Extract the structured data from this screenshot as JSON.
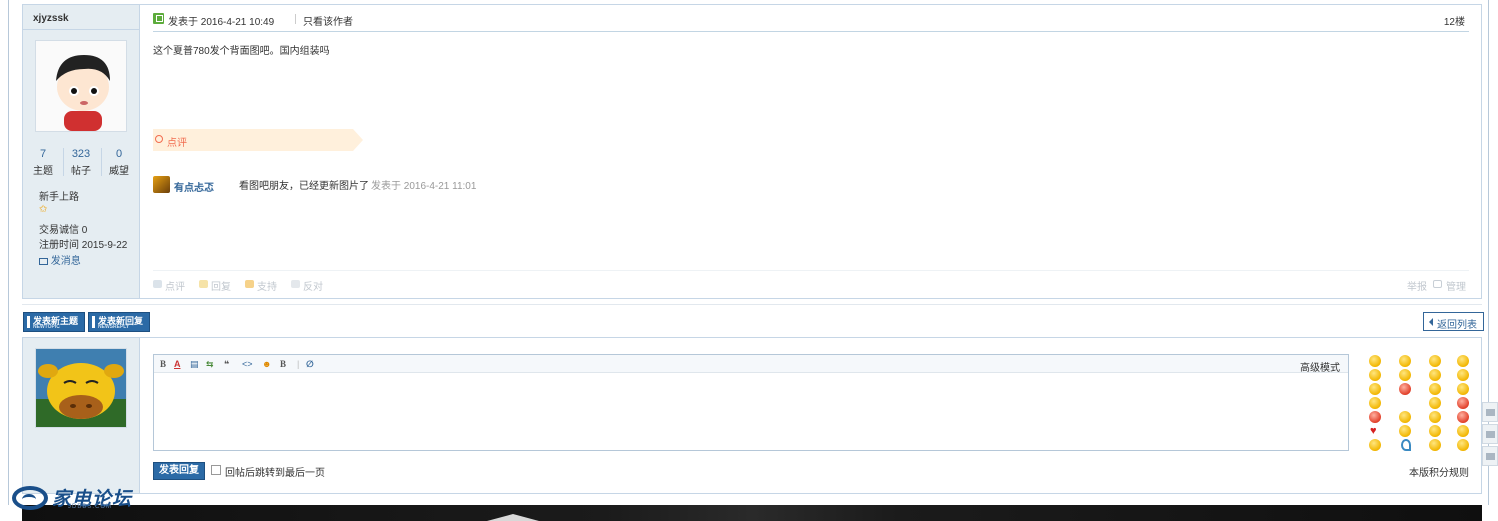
{
  "post": {
    "author": "xjyzssk",
    "stats": [
      {
        "num": "7",
        "label": "主题"
      },
      {
        "num": "323",
        "label": "帖子"
      },
      {
        "num": "0",
        "label": "威望"
      }
    ],
    "rank": "新手上路",
    "trade_credit_label": "交易诚信",
    "trade_credit_value": "0",
    "register_label": "注册时间",
    "register_value": "2015-9-22",
    "send_message": "发消息",
    "posted_at": "发表于 2016-4-21 10:49",
    "only_author": "只看该作者",
    "floor": "12楼",
    "body": "这个夏普780发个背面图吧。国内组装吗",
    "comment_label": "点评",
    "comment": {
      "user": "有点忐忑",
      "text": "看图吧朋友，已经更新图片了",
      "time": "发表于 2016-4-21 11:01"
    },
    "actions": [
      "点评",
      "回复",
      "支持",
      "反对"
    ],
    "right_actions": [
      "举报",
      "管理"
    ]
  },
  "toolbar": {
    "new_topic": "发表新主题",
    "new_topic_en": "NEWTOPIC",
    "new_reply": "发表新回复",
    "new_reply_en": "NEWSREPLY",
    "back_list": "返回列表"
  },
  "reply": {
    "editor_tools": [
      "B",
      "A",
      "▤",
      "⇆",
      "❝",
      "<>",
      "☻",
      "B",
      "|",
      "∅"
    ],
    "advanced_mode": "高级模式",
    "submit": "发表回复",
    "jump_label": "回帖后跳转到最后一页",
    "rules": "本版积分规则"
  },
  "logo": {
    "name": "家电论坛",
    "sub": "JDBBS.COM"
  },
  "colors": {
    "accent": "#336699",
    "button": "#2b6aa6",
    "comment_bg": "#fff0dc",
    "comment_text": "#f26c4f",
    "side_bg": "#e5edf2"
  }
}
